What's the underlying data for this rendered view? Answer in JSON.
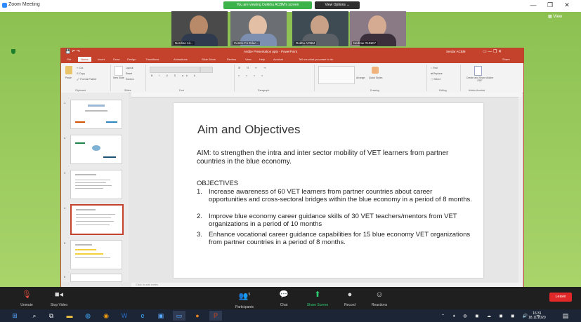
{
  "zoom": {
    "window_title": "Zoom Meeting",
    "share_banner": "You are viewing Dukkhu ACBM's screen",
    "view_options": "View Options ⌄",
    "view_button": "View",
    "leave": "Leave"
  },
  "participants": [
    {
      "name": "Nordine Ait..."
    },
    {
      "name": "Centre Fo Educ..."
    },
    {
      "name": "Dukhu ACBM"
    },
    {
      "name": "Nedlow GUNEY"
    }
  ],
  "ppt": {
    "title": "Antibe Presentation pptx - PowerPoint",
    "user": "Serdar ACBM",
    "tabs": [
      "File",
      "Home",
      "Insert",
      "Draw",
      "Design",
      "Transitions",
      "Animations",
      "Slide Show",
      "Review",
      "View",
      "Help",
      "Acrobat",
      "Tell me what you want to do"
    ],
    "share_label": "Share",
    "ribbon": {
      "paste": "Paste",
      "cut": "Cut",
      "copy": "Copy",
      "format_painter": "Format Painter",
      "clipboard": "Clipboard",
      "new_slide": "New Slide",
      "layout": "Layout",
      "reset": "Reset",
      "section": "Section",
      "slides": "Slides",
      "font": "Font",
      "paragraph": "Paragraph",
      "arrange": "Arrange",
      "quick_styles": "Quick Styles",
      "drawing": "Drawing",
      "find": "Find",
      "replace": "Replace",
      "select": "Select",
      "editing": "Editing",
      "create_share": "Create and Share Adobe PDF",
      "adobe_acrobat": "Adobe Acrobat"
    },
    "notes_placeholder": "Click to add notes"
  },
  "slide": {
    "title": "Aim and Objectives",
    "aim": "AIM: to strengthen the intra and inter sector mobility of VET learners from partner countries in the blue economy.",
    "objectives_heading": "OBJECTIVES",
    "objectives": [
      {
        "num": "1.",
        "text": "Increase awareness of 60 VET learners from partner countries about career opportunities and cross-sectoral bridges within the blue economy in a period of 8 months."
      },
      {
        "num": "2.",
        "text": "Improve blue economy career guidance skills of 30 VET teachers/mentors from VET organizations in a period of 10 months"
      },
      {
        "num": "3.",
        "text": "Enhance vocational career guidance capabilities for 15 blue economy VET organizations from partner countries in a period of 8 months."
      }
    ]
  },
  "thumbnails": [
    {
      "num": "1"
    },
    {
      "num": "2"
    },
    {
      "num": "3"
    },
    {
      "num": "4"
    },
    {
      "num": "5"
    },
    {
      "num": "6"
    }
  ],
  "toolbar": {
    "unmute": "Unmute",
    "stop_video": "Stop Video",
    "participants": "Participants",
    "participants_count": "5",
    "chat": "Chat",
    "share_screen": "Share Screen",
    "record": "Record",
    "reactions": "Reactions"
  },
  "taskbar": {
    "time": "16:31",
    "date": "18.11.2020"
  }
}
